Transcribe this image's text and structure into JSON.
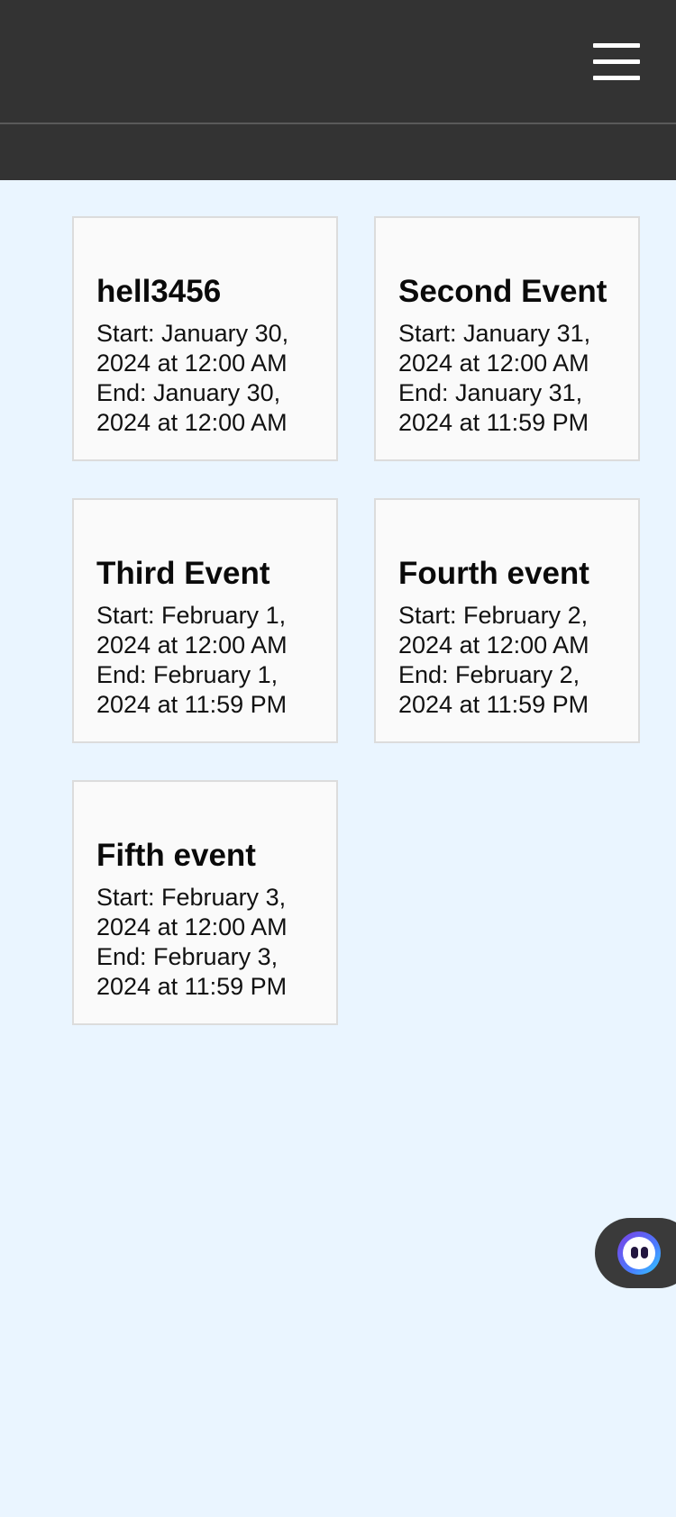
{
  "header": {
    "menu_icon": "hamburger-menu-icon"
  },
  "events": [
    {
      "title": "hell3456",
      "start": "Start: January 30, 2024 at 12:00 AM",
      "end": "End: January 30, 2024 at 12:00 AM"
    },
    {
      "title": "Second Event",
      "start": "Start: January 31, 2024 at 12:00 AM",
      "end": "End: January 31, 2024 at 11:59 PM"
    },
    {
      "title": "Third Event",
      "start": "Start: February 1, 2024 at 12:00 AM",
      "end": "End: February 1, 2024 at 11:59 PM"
    },
    {
      "title": "Fourth event",
      "start": "Start: February 2, 2024 at 12:00 AM",
      "end": "End: February 2, 2024 at 11:59 PM"
    },
    {
      "title": "Fifth event",
      "start": "Start: February 3, 2024 at 12:00 AM",
      "end": "End: February 3, 2024 at 11:59 PM"
    }
  ],
  "chat_widget": {
    "icon": "chat-assistant-icon"
  },
  "colors": {
    "header_bg": "#333333",
    "page_bg": "#eaf5ff",
    "card_bg": "#fafafa",
    "card_border": "#dcdcdc"
  }
}
